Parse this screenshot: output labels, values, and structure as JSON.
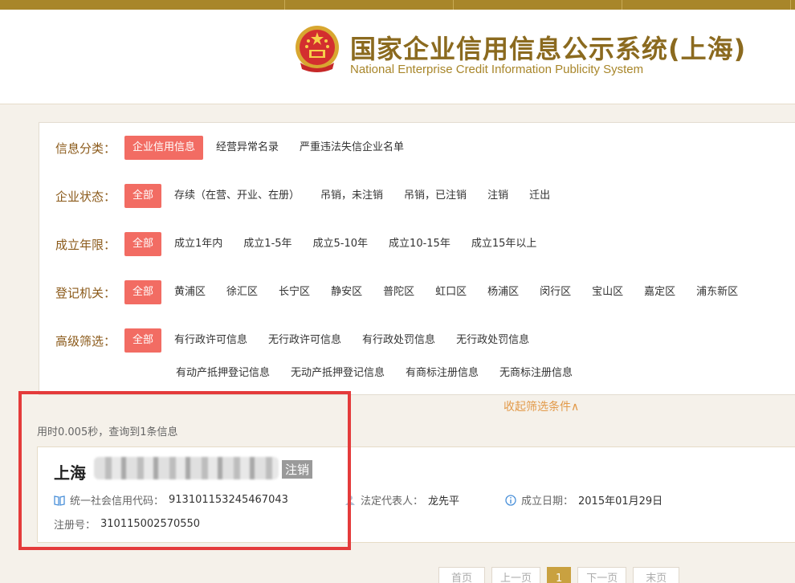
{
  "header": {
    "title_cn": "国家企业信用信息公示系统(上海)",
    "title_en": "National Enterprise Credit Information Publicity System"
  },
  "filters": {
    "category": {
      "label": "信息分类：",
      "options": [
        "企业信用信息",
        "经营异常名录",
        "严重违法失信企业名单"
      ]
    },
    "status": {
      "label": "企业状态：",
      "options": [
        "全部",
        "存续（在营、开业、在册）",
        "吊销，未注销",
        "吊销，已注销",
        "注销",
        "迁出"
      ]
    },
    "founded": {
      "label": "成立年限：",
      "options": [
        "全部",
        "成立1年内",
        "成立1-5年",
        "成立5-10年",
        "成立10-15年",
        "成立15年以上"
      ]
    },
    "authority": {
      "label": "登记机关：",
      "options": [
        "全部",
        "黄浦区",
        "徐汇区",
        "长宁区",
        "静安区",
        "普陀区",
        "虹口区",
        "杨浦区",
        "闵行区",
        "宝山区",
        "嘉定区",
        "浦东新区"
      ]
    },
    "advanced": {
      "label": "高级筛选：",
      "options": [
        "全部",
        "有行政许可信息",
        "无行政许可信息",
        "有行政处罚信息",
        "无行政处罚信息",
        "有动产抵押登记信息",
        "无动产抵押登记信息",
        "有商标注册信息",
        "无商标注册信息"
      ]
    },
    "collapse_label": "收起筛选条件∧"
  },
  "results": {
    "timing": "用时0.005秒，查询到1条信息",
    "company_prefix": "上海",
    "status_badge": "注销",
    "credit_code_label": "统一社会信用代码：",
    "credit_code": "913101153245467043",
    "rep_label": "法定代表人：",
    "rep": "龙先平",
    "date_label": "成立日期：",
    "date": "2015年01月29日",
    "reg_label": "注册号：",
    "reg_no": "310115002570550"
  },
  "pager": {
    "first": "首页",
    "prev": "上一页",
    "current": "1",
    "next": "下一页",
    "last": "末页"
  },
  "colors": {
    "accent": "#f26c63",
    "brand": "#8b6a1f",
    "highlight_frame": "#e43b3b"
  }
}
